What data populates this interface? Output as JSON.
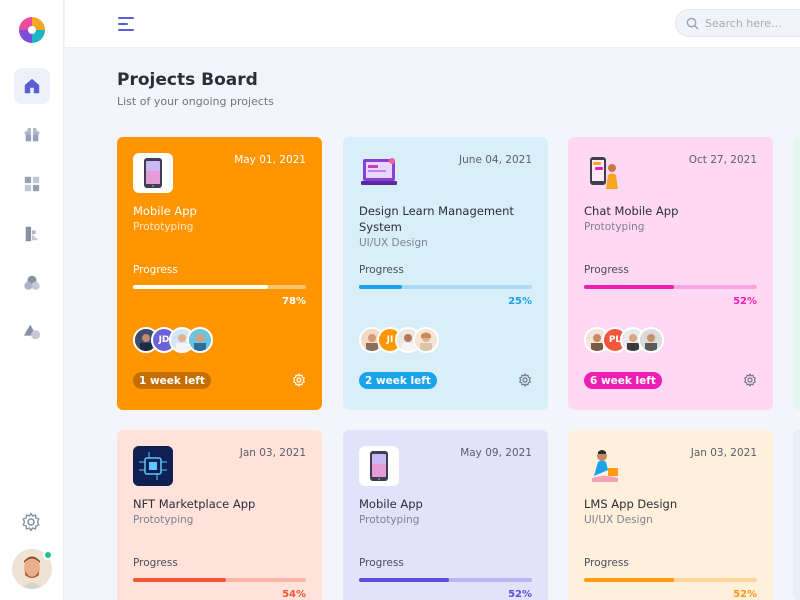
{
  "header": {
    "search_placeholder": "Search here..."
  },
  "page": {
    "title": "Projects Board",
    "subtitle": "List of your ongoing projects"
  },
  "progress_label": "Progress",
  "colors": {
    "orange": "#ff9500",
    "blue": "#1aa3e8",
    "pink": "#ef1fb5",
    "salmon": "#f4563c",
    "indigo": "#5b4fd8",
    "amber": "#ff9a14",
    "online": "#1fc28a"
  },
  "projects": [
    {
      "date": "May 01, 2021",
      "title": "Mobile App",
      "category": "Prototyping",
      "progress_text": "78%",
      "progress": 78,
      "deadline": "1 week left",
      "thumb_icon": "phone-icon"
    },
    {
      "date": "June 04, 2021",
      "title": "Design Learn Management System",
      "category": "UI/UX Design",
      "progress_text": "25%",
      "progress": 25,
      "deadline": "2 week left",
      "thumb_icon": "laptop-illustration-icon"
    },
    {
      "date": "Oct 27, 2021",
      "title": "Chat Mobile App",
      "category": "Prototyping",
      "progress_text": "52%",
      "progress": 52,
      "deadline": "6 week left",
      "thumb_icon": "chat-illustration-icon"
    },
    {
      "date": "Jan 03, 2021",
      "title": "NFT Marketplace App",
      "category": "Prototyping",
      "progress_text": "54%",
      "progress": 54,
      "thumb_icon": "nft-chip-icon"
    },
    {
      "date": "May 09, 2021",
      "title": "Mobile App",
      "category": "Prototyping",
      "progress_text": "52%",
      "progress": 52,
      "thumb_icon": "phone-icon"
    },
    {
      "date": "Jan 03, 2021",
      "title": "LMS App Design",
      "category": "UI/UX Design",
      "progress_text": "52%",
      "progress": 52,
      "thumb_icon": "person-illustration-icon"
    }
  ],
  "avatar_initials": {
    "card1": "JD",
    "card2": "JI",
    "card3": "PL"
  }
}
